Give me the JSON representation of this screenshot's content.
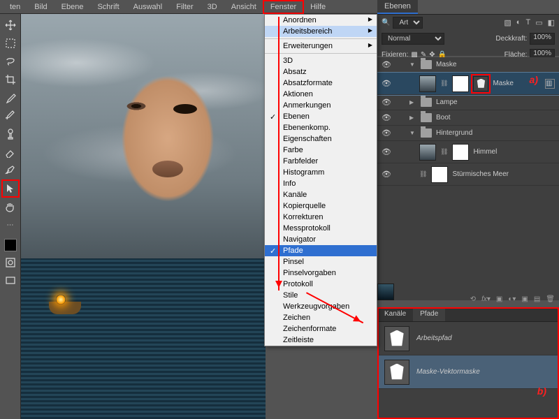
{
  "menubar": {
    "items": [
      "ten",
      "Bild",
      "Ebene",
      "Schrift",
      "Auswahl",
      "Filter",
      "3D",
      "Ansicht",
      "Fenster",
      "Hilfe"
    ],
    "highlight_index": 8
  },
  "dropdown": {
    "groups": [
      [
        {
          "label": "Anordnen",
          "sub": true
        },
        {
          "label": "Arbeitsbereich",
          "sub": true,
          "hover": true
        }
      ],
      [
        {
          "label": "Erweiterungen",
          "sub": true
        }
      ],
      [
        {
          "label": "3D"
        },
        {
          "label": "Absatz"
        },
        {
          "label": "Absatzformate"
        },
        {
          "label": "Aktionen"
        },
        {
          "label": "Anmerkungen"
        },
        {
          "label": "Ebenen",
          "check": true
        },
        {
          "label": "Ebenenkomp."
        },
        {
          "label": "Eigenschaften"
        },
        {
          "label": "Farbe"
        },
        {
          "label": "Farbfelder"
        },
        {
          "label": "Histogramm"
        },
        {
          "label": "Info"
        },
        {
          "label": "Kanäle"
        },
        {
          "label": "Kopierquelle"
        },
        {
          "label": "Korrekturen"
        },
        {
          "label": "Messprotokoll"
        },
        {
          "label": "Navigator"
        },
        {
          "label": "Pfade",
          "check": true,
          "hl": true
        },
        {
          "label": "Pinsel"
        },
        {
          "label": "Pinselvorgaben"
        },
        {
          "label": "Protokoll"
        },
        {
          "label": "Stile"
        },
        {
          "label": "Werkzeugvorgaben"
        },
        {
          "label": "Zeichen"
        },
        {
          "label": "Zeichenformate"
        },
        {
          "label": "Zeitleiste"
        }
      ]
    ]
  },
  "layers_panel": {
    "tab": "Ebenen",
    "filter_label": "Art",
    "blend_mode": "Normal",
    "opacity_label": "Deckkraft:",
    "opacity_value": "100%",
    "lock_label": "Fixieren:",
    "fill_label": "Fläche:",
    "fill_value": "100%",
    "tree": [
      {
        "type": "group",
        "name": "Maske",
        "open": true
      },
      {
        "type": "layer",
        "name": "Maske",
        "sel": true,
        "ann": "a)",
        "vmask": true,
        "indent": 2
      },
      {
        "type": "group",
        "name": "Lampe",
        "open": false,
        "indent": 1
      },
      {
        "type": "group",
        "name": "Boot",
        "open": false,
        "indent": 1
      },
      {
        "type": "group",
        "name": "Hintergrund",
        "open": true,
        "indent": 1
      },
      {
        "type": "layer",
        "name": "Himmel",
        "indent": 2,
        "thumb": "img"
      },
      {
        "type": "layer",
        "name": "Stürmisches Meer",
        "indent": 2,
        "thumb": "sea"
      }
    ]
  },
  "paths_panel": {
    "tabs": [
      "Kanäle",
      "Pfade"
    ],
    "active_tab": 1,
    "rows": [
      {
        "name": "Arbeitspfad"
      },
      {
        "name": "Maske-Vektormaske",
        "sel": true,
        "ann": "b)"
      }
    ]
  }
}
